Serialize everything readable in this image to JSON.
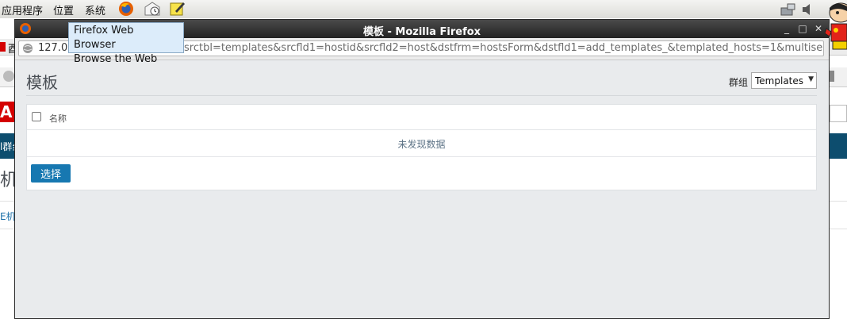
{
  "desktop_panel": {
    "menus": [
      "应用程序",
      "位置",
      "系统"
    ]
  },
  "background_window": {
    "partial_tab_text": "酉",
    "partial_brand": "A",
    "partial_nav": "l群纟",
    "partial_heading": "机",
    "partial_link": "E机"
  },
  "firefox": {
    "window_title": "模板 - Mozilla Firefox",
    "url_start": "127.0",
    "url_visible": "srctbl=templates&srcfld1=hostid&srcfld2=host&dstfrm=hostsForm&dstfld1=add_templates_&templated_hosts=1&multisele",
    "tooltip_line1": "Firefox Web Browser",
    "tooltip_line2": "Browse the Web"
  },
  "page": {
    "heading": "模板",
    "group_label": "群组",
    "group_selected": "Templates",
    "table": {
      "columns": [
        "名称"
      ],
      "empty_message": "未发现数据"
    },
    "select_button": "选择"
  },
  "colors": {
    "accent_button": "#1778b1",
    "content_bg": "#e9ebed",
    "title_bar": "#2e2e2e",
    "bg_nav": "#0d4d6e",
    "bg_brand": "#d40000"
  }
}
